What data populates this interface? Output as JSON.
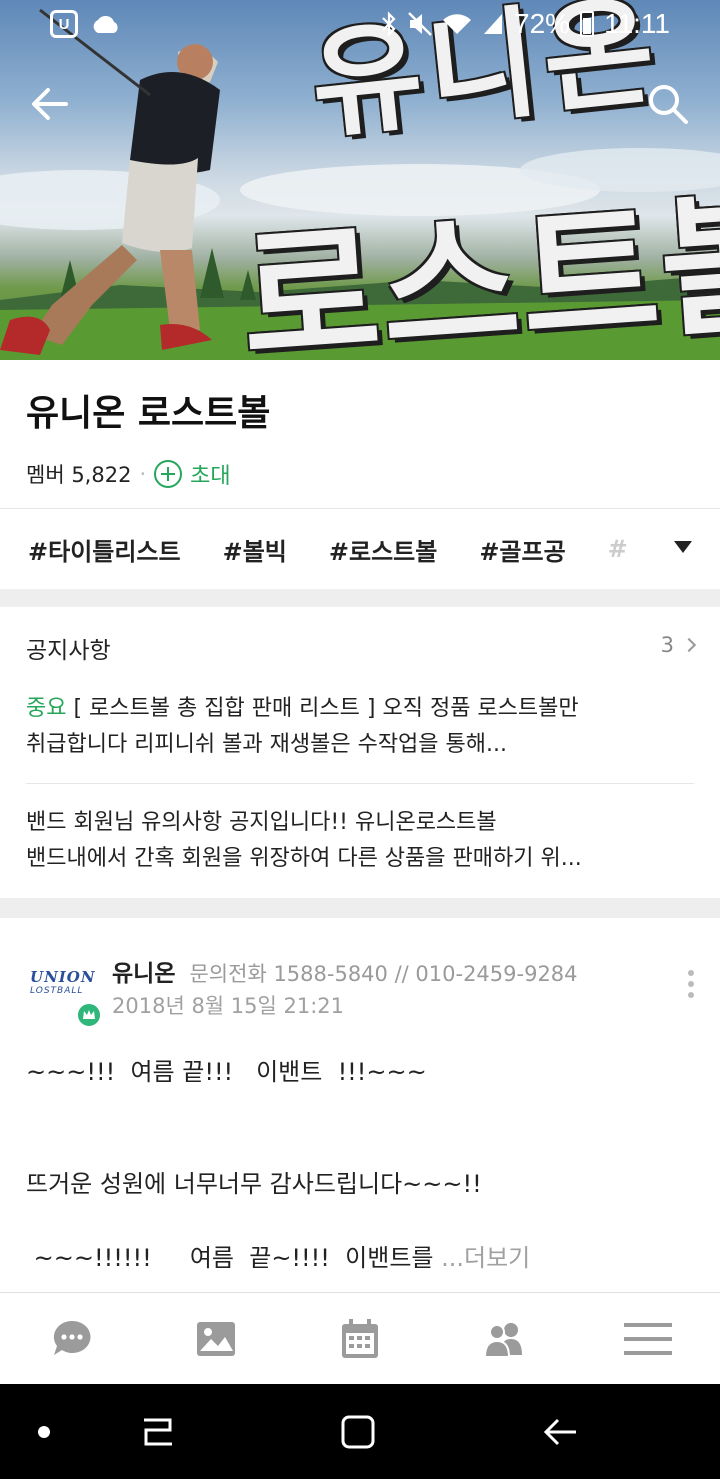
{
  "status_bar": {
    "carrier_badge": "U",
    "battery": "72%",
    "time": "11:11",
    "icons": [
      "cloud-icon",
      "bluetooth-icon",
      "mute-icon",
      "wifi-icon",
      "signal-icon",
      "battery-icon"
    ]
  },
  "cover": {
    "title_line1": "유니온",
    "title_line2": "로스트볼"
  },
  "band": {
    "name": "유니온 로스트볼",
    "member_count": "멤버 5,822",
    "separator": "·",
    "invite_label": "초대"
  },
  "tags": [
    "#타이틀리스트",
    "#볼빅",
    "#로스트볼",
    "#골프공",
    "#"
  ],
  "notice": {
    "title": "공지사항",
    "count": "3",
    "items": [
      {
        "badge": "중요",
        "line1": " [ 로스트볼 총 집합 판매 리스트 ]   오직 정품 로스트볼만",
        "line2": "취급합니다 리피니쉬 볼과 재생볼은 수작업을 통해..."
      },
      {
        "line1": "밴드 회원님 유의사항 공지입니다!!  유니온로스트볼",
        "line2": "밴드내에서 간혹 회원을 위장하여 다른 상품을 판매하기 위..."
      }
    ]
  },
  "post": {
    "avatar_logo_line1": "UNION",
    "avatar_logo_line2": "LOSTBALL",
    "author": "유니온",
    "author_desc": "문의전화 1588-5840  //  010-2459-9284",
    "date": "2018년 8월 15일 21:21",
    "line1": "~~~!!!  여름 끝!!!   이밴트  !!!~~~",
    "line2": "뜨거운 성원에 너무너무 감사드립니다~~~!!",
    "line3": " ~~~!!!!!!     여름  끝~!!!!  이밴트를 ",
    "more": "...더보기"
  },
  "bottom_tabs": [
    "chat-icon",
    "photo-icon",
    "calendar-icon",
    "members-icon",
    "menu-icon"
  ],
  "colors": {
    "accent_green": "#26a65b",
    "gray_text": "#9a9a9a",
    "divider": "#eeeeee"
  }
}
